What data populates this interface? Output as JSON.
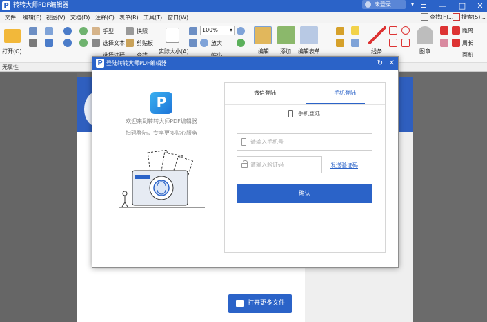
{
  "app": {
    "title": "转转大师PDF编辑器",
    "logo": "P"
  },
  "title_bar": {
    "login_status": "未登录",
    "minimize": "—",
    "maximize": "□",
    "close": "✕"
  },
  "menu": {
    "items": [
      "文件",
      "编辑(E)",
      "视图(V)",
      "文档(D)",
      "注释(C)",
      "表单(R)",
      "工具(T)",
      "窗口(W)"
    ],
    "find": "查找(F)...",
    "search": "搜索(S)..."
  },
  "ribbon": {
    "open": "打开(O)...",
    "hand": "手型",
    "select_text": "选择文本",
    "select_annot": "选择注释",
    "snapshot": "快照",
    "clipboard": "剪贴板",
    "find": "查找",
    "actual_size": "实际大小(A)",
    "zoom": "100%",
    "zoom_in": "放大",
    "zoom_out": "缩小",
    "edit": "编辑",
    "add": "添加",
    "edit_form": "编辑表单",
    "line": "线条",
    "stamp": "图章",
    "distance": "距离",
    "perimeter": "周长",
    "area": "面积",
    "bottom_label": "无属性"
  },
  "document": {
    "open_more": "打开更多文件"
  },
  "login_dialog": {
    "title": "登陆转转大师PDF编辑器",
    "welcome": "欢迎来到转转大师PDF编辑器",
    "subtitle": "扫码登陆，专享更多贴心服务",
    "tabs": [
      "微信登陆",
      "手机登陆"
    ],
    "active_tab": "手机登陆",
    "mode_label": "手机登陆",
    "phone_placeholder": "请输入手机号",
    "code_placeholder": "请输入验证码",
    "send_code": "发送验证码",
    "confirm": "确认"
  },
  "colors": {
    "brand_blue": "#2b63c8",
    "title_bar": "#2b63c8",
    "dark_bg": "#6b6b6b"
  }
}
